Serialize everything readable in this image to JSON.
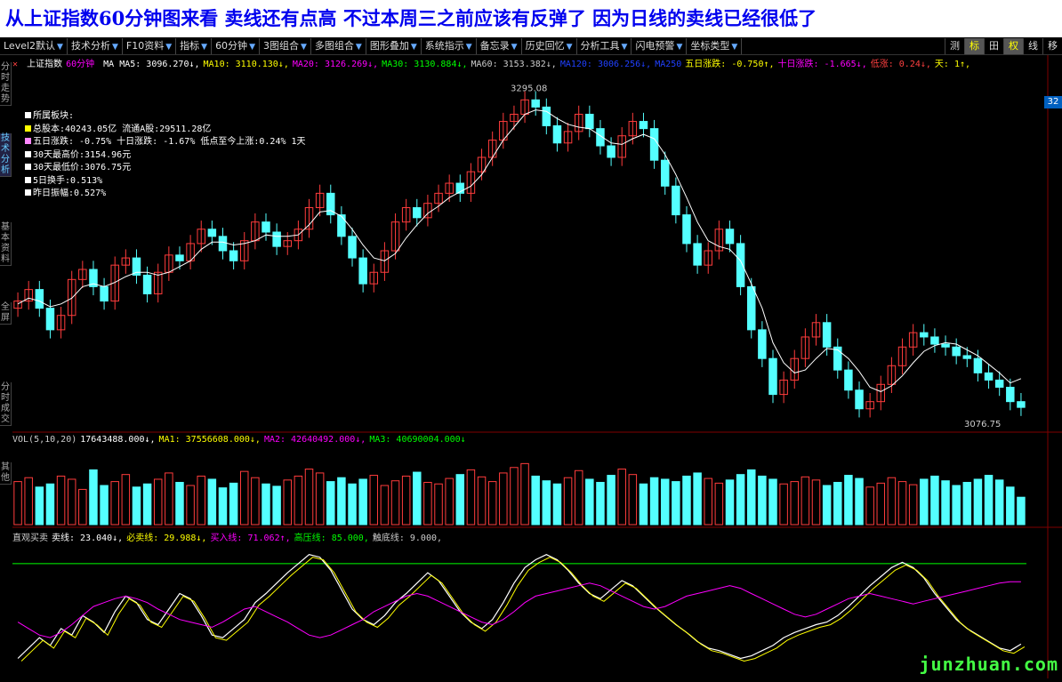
{
  "banner": {
    "text": "从上证指数60分钟图来看 卖线还有点高 不过本周三之前应该有反弹了 因为日线的卖线已经很低了"
  },
  "toolbar": {
    "items": [
      "Level2默认",
      "技术分析",
      "F10资料",
      "指标",
      "60分钟",
      "3图组合",
      "多图组合",
      "图形叠加",
      "系统指示",
      "备忘录",
      "历史回忆",
      "分析工具",
      "闪电预警",
      "坐标类型"
    ],
    "right": [
      "测",
      "标",
      "田",
      "权",
      "线",
      "移"
    ]
  },
  "sidebar": {
    "tabs": [
      "分时走势",
      "技术分析",
      "基本资料",
      "全屏",
      "分时成交",
      "其他"
    ]
  },
  "price_legend": {
    "title": "上证指数",
    "period": "60分钟",
    "items": [
      {
        "text": "MA MA5: 3096.270↓,",
        "color": "#ffffff"
      },
      {
        "text": "MA10: 3110.130↓,",
        "color": "#ffff00"
      },
      {
        "text": "MA20: 3126.269↓,",
        "color": "#ff00ff"
      },
      {
        "text": "MA30: 3130.884↓,",
        "color": "#00ff00"
      },
      {
        "text": "MA60: 3153.382↓,",
        "color": "#cccccc"
      },
      {
        "text": "MA120: 3006.256↓,",
        "color": "#2040ff"
      },
      {
        "text": "MA250",
        "color": "#2040ff"
      },
      {
        "text": "五日涨跌: -0.750↑,",
        "color": "#ffff00"
      },
      {
        "text": "十日涨跌: -1.665↓,",
        "color": "#ff00ff"
      },
      {
        "text": "低涨: 0.24↓,",
        "color": "#ff4040"
      },
      {
        "text": "天: 1↑,",
        "color": "#ffff00"
      }
    ]
  },
  "info_box": {
    "lines": [
      "所属板块:",
      "总股本:40243.05亿  流通A股:29511.28亿",
      "五日涨跌: -0.75%   十日涨跌: -1.67%  低点至今上涨:0.24%  1天",
      "30天最高价:3154.96元",
      "30天最低价:3076.75元",
      "5日换手:0.513%",
      "昨日振幅:0.527%"
    ]
  },
  "price_badge": "32",
  "vol_legend": {
    "items": [
      {
        "text": "VOL(5,10,20)",
        "color": "#cccccc"
      },
      {
        "text": "17643488.000↓,",
        "color": "#ffffff"
      },
      {
        "text": "MA1: 37556608.000↓,",
        "color": "#ffff00"
      },
      {
        "text": "MA2: 42640492.000↓,",
        "color": "#ff00ff"
      },
      {
        "text": "MA3: 40690004.000↓",
        "color": "#00ff00"
      }
    ]
  },
  "ind_legend": {
    "items": [
      {
        "text": "直观买卖",
        "color": "#cccccc"
      },
      {
        "text": "卖线: 23.040↓,",
        "color": "#ffffff"
      },
      {
        "text": "必卖线: 29.988↓,",
        "color": "#ffff00"
      },
      {
        "text": "买入线: 71.062↑,",
        "color": "#ff00ff"
      },
      {
        "text": "高压线: 85.000,",
        "color": "#00ff00"
      },
      {
        "text": "触底线: 9.000,",
        "color": "#cccccc"
      }
    ]
  },
  "watermark": "junzhuan.com",
  "chart_data": {
    "type": "candlestick",
    "price_range": [
      3060,
      3310
    ],
    "high_label": "3295.08",
    "low_label": "3076.75",
    "closes": [
      3150,
      3158,
      3145,
      3130,
      3140,
      3165,
      3172,
      3160,
      3150,
      3175,
      3180,
      3168,
      3155,
      3170,
      3182,
      3178,
      3190,
      3200,
      3195,
      3185,
      3178,
      3192,
      3205,
      3198,
      3188,
      3192,
      3200,
      3215,
      3225,
      3210,
      3195,
      3180,
      3162,
      3170,
      3185,
      3205,
      3215,
      3208,
      3218,
      3225,
      3232,
      3225,
      3240,
      3250,
      3262,
      3275,
      3280,
      3290,
      3285,
      3272,
      3260,
      3268,
      3280,
      3270,
      3258,
      3250,
      3265,
      3275,
      3270,
      3248,
      3230,
      3210,
      3190,
      3175,
      3185,
      3200,
      3190,
      3160,
      3130,
      3110,
      3085,
      3095,
      3110,
      3125,
      3135,
      3118,
      3102,
      3088,
      3075,
      3080,
      3092,
      3105,
      3118,
      3128,
      3125,
      3120,
      3118,
      3112,
      3110,
      3100,
      3095,
      3090,
      3080,
      3076
    ],
    "ma5": [
      3148,
      3152,
      3150,
      3146,
      3148,
      3152,
      3160,
      3162,
      3160,
      3163,
      3167,
      3170,
      3170,
      3168,
      3170,
      3174,
      3178,
      3186,
      3191,
      3191,
      3189,
      3190,
      3192,
      3196,
      3195,
      3195,
      3196,
      3203,
      3212,
      3213,
      3209,
      3200,
      3189,
      3180,
      3178,
      3183,
      3194,
      3203,
      3211,
      3216,
      3222,
      3226,
      3230,
      3238,
      3250,
      3262,
      3271,
      3280,
      3283,
      3282,
      3277,
      3273,
      3271,
      3270,
      3265,
      3260,
      3259,
      3263,
      3266,
      3263,
      3252,
      3238,
      3222,
      3205,
      3192,
      3188,
      3186,
      3178,
      3162,
      3145,
      3121,
      3107,
      3100,
      3102,
      3110,
      3117,
      3116,
      3110,
      3101,
      3090,
      3087,
      3091,
      3098,
      3107,
      3115,
      3119,
      3121,
      3120,
      3116,
      3112,
      3106,
      3100,
      3093,
      3096
    ],
    "volume_range": [
      0,
      100
    ],
    "volumes": [
      55,
      60,
      48,
      52,
      62,
      58,
      45,
      70,
      50,
      55,
      64,
      48,
      52,
      58,
      66,
      54,
      50,
      62,
      58,
      47,
      53,
      68,
      60,
      52,
      49,
      57,
      62,
      71,
      66,
      55,
      60,
      52,
      58,
      63,
      50,
      56,
      62,
      67,
      54,
      52,
      59,
      64,
      70,
      61,
      55,
      66,
      73,
      78,
      62,
      56,
      52,
      60,
      69,
      58,
      54,
      63,
      71,
      64,
      52,
      60,
      58,
      55,
      62,
      66,
      59,
      53,
      57,
      64,
      70,
      62,
      58,
      52,
      55,
      61,
      57,
      50,
      54,
      63,
      59,
      48,
      53,
      60,
      55,
      51,
      58,
      62,
      56,
      50,
      54,
      58,
      63,
      57,
      48,
      35
    ],
    "indicator_range": [
      0,
      100
    ],
    "sell_line": [
      12,
      20,
      28,
      22,
      35,
      30,
      45,
      40,
      32,
      48,
      60,
      55,
      42,
      38,
      50,
      62,
      58,
      45,
      30,
      28,
      35,
      42,
      55,
      62,
      70,
      78,
      85,
      92,
      90,
      80,
      65,
      50,
      42,
      38,
      45,
      55,
      62,
      70,
      78,
      72,
      60,
      48,
      40,
      35,
      42,
      55,
      70,
      82,
      88,
      92,
      88,
      80,
      70,
      62,
      58,
      65,
      72,
      68,
      60,
      52,
      45,
      38,
      32,
      25,
      20,
      18,
      15,
      12,
      14,
      18,
      22,
      28,
      32,
      35,
      38,
      40,
      45,
      52,
      60,
      68,
      75,
      82,
      86,
      82,
      74,
      62,
      52,
      42,
      35,
      30,
      25,
      20,
      18,
      23
    ],
    "buy_line": [
      40,
      35,
      30,
      28,
      32,
      38,
      45,
      52,
      55,
      58,
      60,
      58,
      55,
      50,
      46,
      42,
      40,
      38,
      36,
      40,
      45,
      50,
      52,
      48,
      44,
      40,
      35,
      30,
      28,
      30,
      34,
      38,
      42,
      48,
      52,
      56,
      60,
      62,
      60,
      56,
      52,
      48,
      44,
      40,
      38,
      42,
      48,
      55,
      60,
      62,
      64,
      66,
      68,
      70,
      68,
      64,
      60,
      56,
      52,
      50,
      52,
      56,
      60,
      62,
      64,
      66,
      68,
      66,
      62,
      58,
      54,
      50,
      46,
      44,
      46,
      50,
      54,
      58,
      60,
      62,
      60,
      58,
      56,
      54,
      56,
      58,
      60,
      62,
      64,
      66,
      68,
      70,
      71,
      71
    ],
    "high_pressure": 85,
    "bottom_line": 9
  }
}
